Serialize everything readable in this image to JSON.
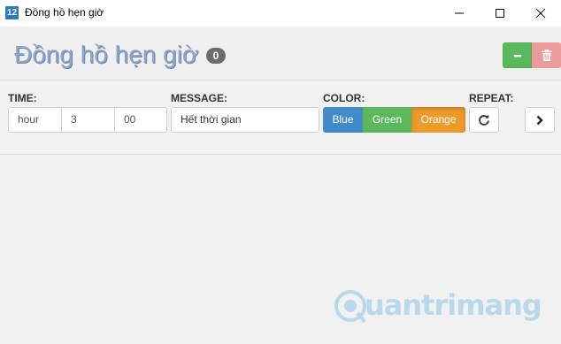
{
  "window": {
    "icon_text": "12",
    "title": "Đồng hồ hẹn giờ"
  },
  "header": {
    "title": "Đồng hồ hẹn giờ",
    "badge_count": "0"
  },
  "form": {
    "time_label": "TIME:",
    "time_fields": [
      "hour",
      "3",
      "00"
    ],
    "message_label": "MESSAGE:",
    "message_value": "Hết thời gian",
    "color_label": "COLOR:",
    "color_options": [
      "Blue",
      "Green",
      "Orange"
    ],
    "selected_color": "Orange",
    "repeat_label": "REPEAT:"
  },
  "watermark": {
    "text": "uantrimang"
  },
  "colors": {
    "blue": "#428bca",
    "green": "#5cb85c",
    "orange": "#ec9a2c",
    "danger": "#ed9a9a",
    "title": "#8fa4c6"
  },
  "icons": {
    "app": "app-icon",
    "minimize": "window-minimize-icon",
    "maximize": "window-maximize-icon",
    "close": "window-close-icon",
    "minus": "minus-icon",
    "trash": "trash-icon",
    "repeat": "refresh-icon",
    "next": "chevron-right-icon"
  }
}
